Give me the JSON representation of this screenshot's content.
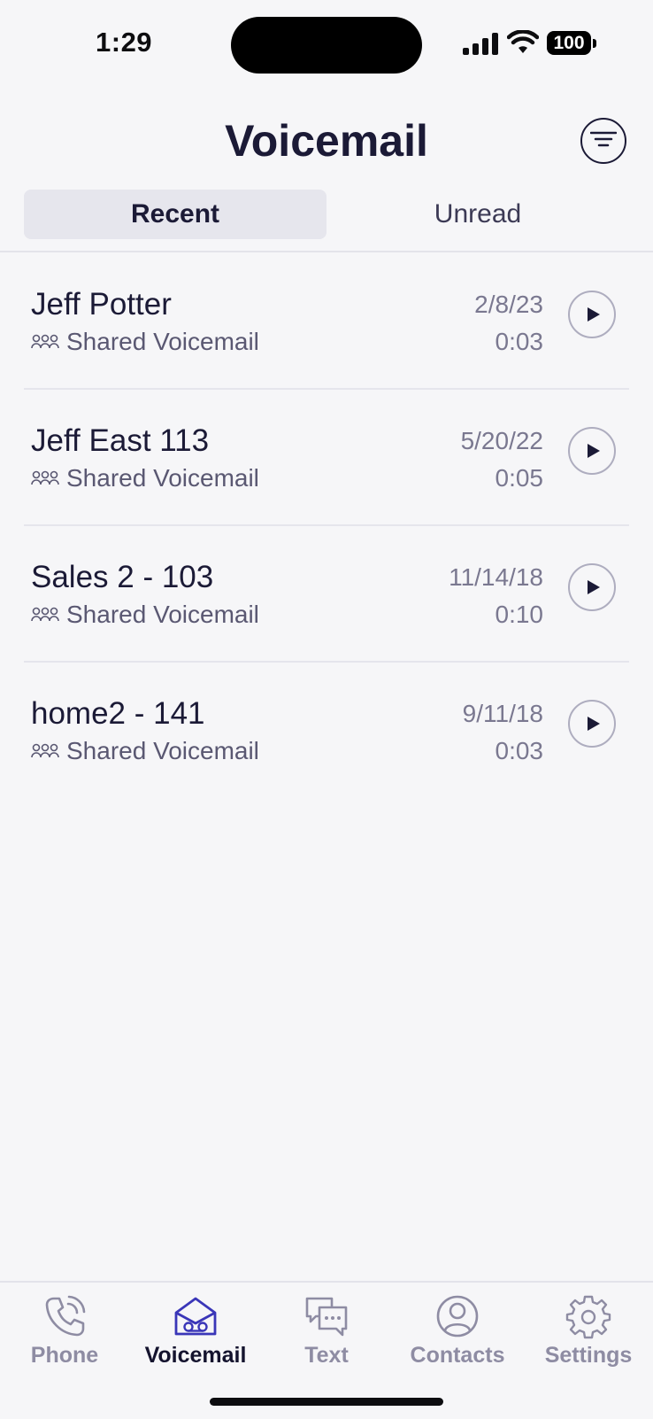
{
  "status_bar": {
    "time": "1:29",
    "battery": "100",
    "icons": [
      "signal-icon",
      "wifi-icon",
      "battery-icon"
    ]
  },
  "header": {
    "title": "Voicemail",
    "filter_icon": "filter-icon"
  },
  "tabs": {
    "recent": "Recent",
    "unread": "Unread",
    "selected": "Recent"
  },
  "voicemails": [
    {
      "name": "Jeff Potter",
      "type": "Shared Voicemail",
      "date": "2/8/23",
      "duration": "0:03"
    },
    {
      "name": "Jeff East 113",
      "type": "Shared Voicemail",
      "date": "5/20/22",
      "duration": "0:05"
    },
    {
      "name": "Sales 2 - 103",
      "type": "Shared Voicemail",
      "date": "11/14/18",
      "duration": "0:10"
    },
    {
      "name": "home2 - 141",
      "type": "Shared Voicemail",
      "date": "9/11/18",
      "duration": "0:03"
    }
  ],
  "tab_bar": {
    "items": [
      {
        "label": "Phone",
        "icon": "phone-icon"
      },
      {
        "label": "Voicemail",
        "icon": "voicemail-icon",
        "active": true
      },
      {
        "label": "Text",
        "icon": "chat-icon"
      },
      {
        "label": "Contacts",
        "icon": "contact-icon"
      },
      {
        "label": "Settings",
        "icon": "gear-icon"
      }
    ]
  },
  "colors": {
    "background": "#f6f6f8",
    "title": "#1b1a36",
    "inactive_tab": "#8e8ca3",
    "active_tab": "#14132e",
    "voicemail_icon_active": "#3a36b8"
  }
}
